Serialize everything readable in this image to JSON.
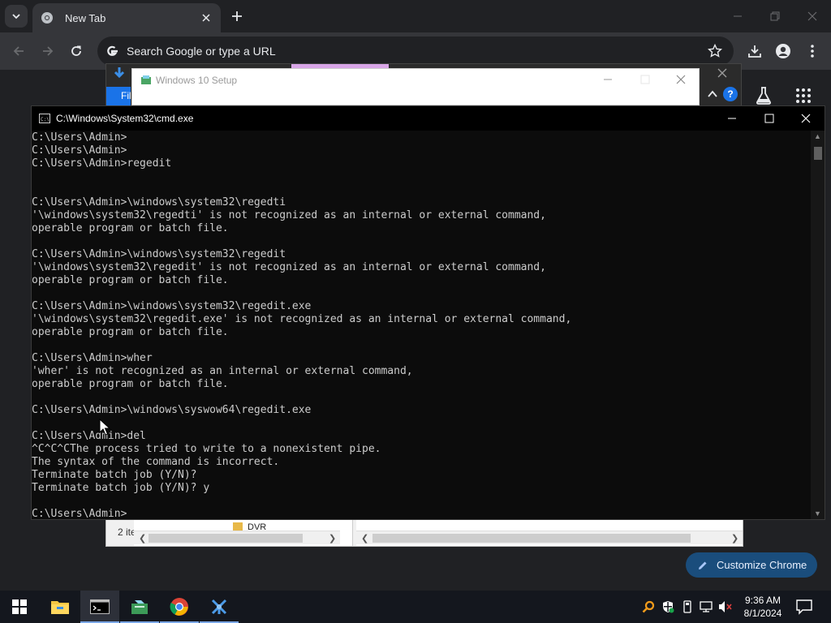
{
  "chrome": {
    "tab_title": "New Tab",
    "omnibox_placeholder": "Search Google or type a URL",
    "customize_label": "Customize Chrome"
  },
  "setup_window": {
    "title": "Windows 10 Setup"
  },
  "background_window": {
    "file_tab_label": "Fil",
    "help_label": "?"
  },
  "explorer": {
    "status_items": "2 ite",
    "folder_name": "DVR"
  },
  "cmd": {
    "title": "C:\\Windows\\System32\\cmd.exe",
    "lines": [
      "C:\\Users\\Admin>",
      "C:\\Users\\Admin>",
      "C:\\Users\\Admin>regedit",
      "",
      "",
      "C:\\Users\\Admin>\\windows\\system32\\regedti",
      "'\\windows\\system32\\regedti' is not recognized as an internal or external command,",
      "operable program or batch file.",
      "",
      "C:\\Users\\Admin>\\windows\\system32\\regedit",
      "'\\windows\\system32\\regedit' is not recognized as an internal or external command,",
      "operable program or batch file.",
      "",
      "C:\\Users\\Admin>\\windows\\system32\\regedit.exe",
      "'\\windows\\system32\\regedit.exe' is not recognized as an internal or external command,",
      "operable program or batch file.",
      "",
      "C:\\Users\\Admin>wher",
      "'wher' is not recognized as an internal or external command,",
      "operable program or batch file.",
      "",
      "C:\\Users\\Admin>\\windows\\syswow64\\regedit.exe",
      "",
      "C:\\Users\\Admin>del",
      "^C^C^CThe process tried to write to a nonexistent pipe.",
      "The syntax of the command is incorrect.",
      "Terminate batch job (Y/N)?",
      "Terminate batch job (Y/N)? y",
      "",
      "C:\\Users\\Admin>"
    ]
  },
  "taskbar": {
    "time": "9:36 AM",
    "date": "8/1/2024",
    "apps": [
      "start-button",
      "file-explorer",
      "command-prompt",
      "setup-app",
      "chrome",
      "network-tool"
    ]
  },
  "colors": {
    "chrome_bg": "#202124",
    "toolbar_bg": "#35363a",
    "cmd_bg": "#0c0c0c",
    "cmd_text": "#cccccc",
    "taskbar_bg": "#14171e",
    "customize_bg": "#1a4d7c"
  }
}
